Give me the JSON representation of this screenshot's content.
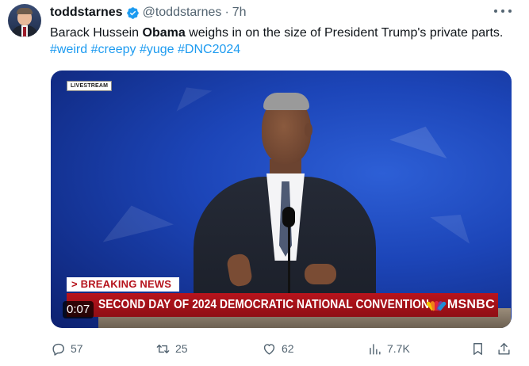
{
  "author": {
    "display_name": "toddstarnes",
    "handle": "@toddstarnes",
    "separator": "·",
    "time": "7h",
    "verified": true,
    "avatar_icon": "profile-photo"
  },
  "tweet": {
    "text_prefix": "Barack Hussein ",
    "text_bold": "Obama",
    "text_suffix": " weighs in on the size of President Trump's private parts. ",
    "hashtags": [
      "#weird",
      "#creepy",
      "#yuge",
      "#DNC2024"
    ]
  },
  "media": {
    "type": "video",
    "corner_label": "LIVESTREAM",
    "breaking_label": "> BREAKING NEWS",
    "headline": "SECOND DAY OF 2024 DEMOCRATIC NATIONAL CONVENTION",
    "network": "MSNBC",
    "elapsed": "0:07"
  },
  "actions": {
    "replies": "57",
    "retweets": "25",
    "likes": "62",
    "views": "7.7K"
  },
  "colors": {
    "accent": "#1d9bf0",
    "muted": "#536471",
    "breaking_red": "#b5121b"
  }
}
